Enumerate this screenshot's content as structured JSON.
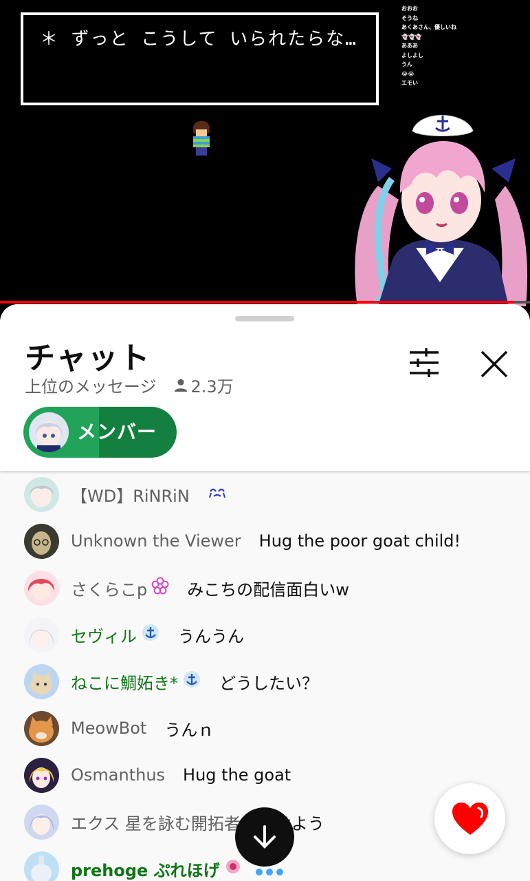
{
  "video": {
    "dialog_text": "＊ ずっと こうして いられたらな…",
    "overlay_chat": [
      "おおお",
      "そうね",
      "あくあさん、優しいね",
      "👻👻👻",
      "あああ",
      "よしよし",
      "うん",
      "😭😭",
      "エモい"
    ],
    "progress_fraction": 0.97
  },
  "chat": {
    "title": "チャット",
    "mode": "上位のメッセージ",
    "viewer_count": "2.3万",
    "member_chip_label": "メンバー",
    "messages": [
      {
        "author": "【WD】RiNRiN",
        "text": "",
        "member": false,
        "badge": "crying-emoji"
      },
      {
        "author": "Unknown the Viewer",
        "text": "Hug the poor goat child!",
        "member": false
      },
      {
        "author": "さくらこp",
        "text": "みこちの配信面白いw",
        "member": false,
        "badge": "flower-icon"
      },
      {
        "author": "セヴィル",
        "text": "うんうん",
        "member": true,
        "badge": "member-anchor-badge"
      },
      {
        "author": "ねこに鯛妬き*",
        "text": "どうしたい？",
        "member": true,
        "badge": "member-anchor-badge"
      },
      {
        "author": "MeowBot",
        "text": "うんｎ",
        "member": false
      },
      {
        "author": "Osmanthus",
        "text": "Hug the goat",
        "member": false
      },
      {
        "author": "エクス 星を詠む開拓者",
        "text": "おはよう",
        "member": false
      },
      {
        "author": "prehoge ぷれほげ",
        "text": "",
        "member": true,
        "badge": "member-badge"
      }
    ]
  },
  "colors": {
    "member_name": "#107516",
    "author_name": "#606060",
    "progress": "#ff0000",
    "chip_green": "#14803f",
    "heart": "#ff0000"
  }
}
